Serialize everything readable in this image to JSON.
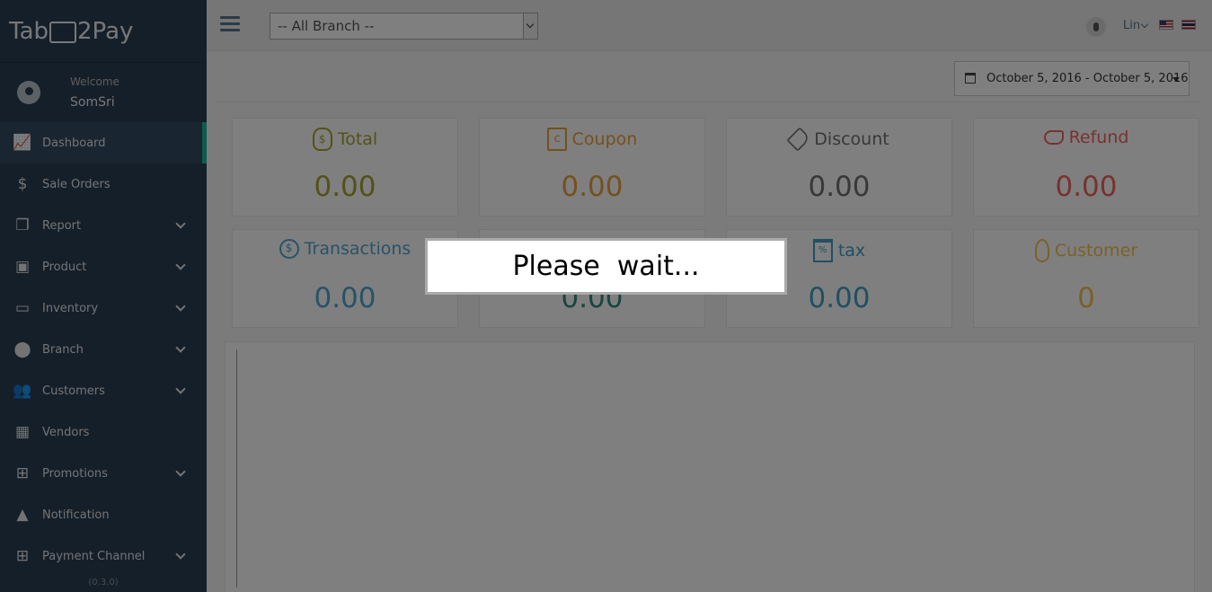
{
  "brand": {
    "logo_left": "Tab",
    "logo_right": "2Pay"
  },
  "profile": {
    "welcome": "Welcome",
    "name": "SomSri"
  },
  "sidebar": {
    "items": [
      {
        "label": "Dashboard",
        "icon": "area-chart-icon",
        "glyph": "📈",
        "has_submenu": false,
        "active": true
      },
      {
        "label": "Sale Orders",
        "icon": "dollar-icon",
        "glyph": "$",
        "has_submenu": false
      },
      {
        "label": "Report",
        "icon": "files-icon",
        "glyph": "❐",
        "has_submenu": true
      },
      {
        "label": "Product",
        "icon": "briefcase-icon",
        "glyph": "▣",
        "has_submenu": true
      },
      {
        "label": "Inventory",
        "icon": "inbox-icon",
        "glyph": "▭",
        "has_submenu": true
      },
      {
        "label": "Branch",
        "icon": "map-marker-icon",
        "glyph": "⬤",
        "has_submenu": true
      },
      {
        "label": "Customers",
        "icon": "users-icon",
        "glyph": "👥",
        "has_submenu": true
      },
      {
        "label": "Vendors",
        "icon": "building-icon",
        "glyph": "▦",
        "has_submenu": false
      },
      {
        "label": "Promotions",
        "icon": "gift-icon",
        "glyph": "⊞",
        "has_submenu": true
      },
      {
        "label": "Notification",
        "icon": "warning-icon",
        "glyph": "▲",
        "has_submenu": false
      },
      {
        "label": "Payment Channel",
        "icon": "gift-icon",
        "glyph": "⊞",
        "has_submenu": true
      }
    ],
    "version": "(0.3.0)"
  },
  "topbar": {
    "branch_select": "-- All Branch --",
    "user": "Lin"
  },
  "date_range": "October 5, 2016 - October 5, 2016",
  "tiles": [
    {
      "label": "Total",
      "value": "0.00",
      "color": "#a5a531",
      "icon": "money-bag-icon"
    },
    {
      "label": "Coupon",
      "value": "0.00",
      "color": "#e8a33c",
      "icon": "coupon-icon"
    },
    {
      "label": "Discount",
      "value": "0.00",
      "color": "#707070",
      "icon": "tag-icon"
    },
    {
      "label": "Refund",
      "value": "0.00",
      "color": "#f0655f",
      "icon": "refund-hand-icon"
    },
    {
      "label": "Transactions",
      "value": "0.00",
      "color": "#4fa6d2",
      "icon": "coins-icon"
    },
    {
      "label": "",
      "value": "0.00",
      "color": "#2f8f7e",
      "icon": "hidden-tile-icon"
    },
    {
      "label": "tax",
      "value": "0.00",
      "color": "#3fa1c7",
      "icon": "tax-calendar-icon"
    },
    {
      "label": "Customer",
      "value": "0",
      "color": "#f4c253",
      "icon": "customer-icon"
    }
  ],
  "loading": {
    "message": "Please  wait..."
  }
}
